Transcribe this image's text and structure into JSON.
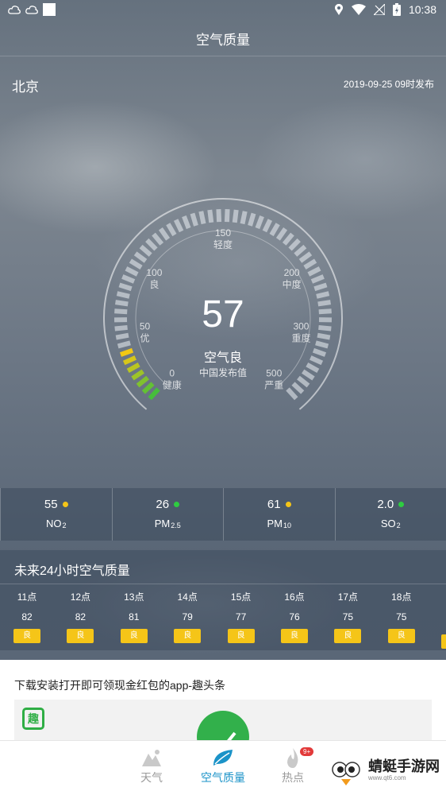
{
  "status_bar": {
    "time": "10:38"
  },
  "header": {
    "title": "空气质量"
  },
  "location": {
    "city": "北京",
    "publish_time": "2019-09-25 09时发布"
  },
  "gauge": {
    "value": "57",
    "level": "空气良",
    "source": "中国发布值",
    "fraction": 0.114,
    "labels": [
      {
        "value": "0",
        "level": "健康"
      },
      {
        "value": "50",
        "level": "优"
      },
      {
        "value": "100",
        "level": "良"
      },
      {
        "value": "150",
        "level": "轻度"
      },
      {
        "value": "200",
        "level": "中度"
      },
      {
        "value": "300",
        "level": "重度"
      },
      {
        "value": "500",
        "level": "严重"
      }
    ]
  },
  "pollutants": [
    {
      "value": "55",
      "name": "NO",
      "sub": "2",
      "status_color": "#f5c518"
    },
    {
      "value": "26",
      "name": "PM",
      "sub": "2.5",
      "status_color": "#2ecc40"
    },
    {
      "value": "61",
      "name": "PM",
      "sub": "10",
      "status_color": "#f5c518"
    },
    {
      "value": "2.0",
      "name": "SO",
      "sub": "2",
      "status_color": "#2ecc40"
    }
  ],
  "forecast": {
    "title": "未来24小时空气质量",
    "hours": [
      {
        "time": "11点",
        "value": "82",
        "level": "良"
      },
      {
        "time": "12点",
        "value": "82",
        "level": "良"
      },
      {
        "time": "13点",
        "value": "81",
        "level": "良"
      },
      {
        "time": "14点",
        "value": "79",
        "level": "良"
      },
      {
        "time": "15点",
        "value": "77",
        "level": "良"
      },
      {
        "time": "16点",
        "value": "76",
        "level": "良"
      },
      {
        "time": "17点",
        "value": "75",
        "level": "良"
      },
      {
        "time": "18点",
        "value": "75",
        "level": "良"
      }
    ],
    "level_color": "#f5c518"
  },
  "ad": {
    "text": "下载安装打开即可领现金红包的app-趣头条",
    "logo_char": "趣"
  },
  "tabs": [
    {
      "label": "天气",
      "icon": "mountain-icon"
    },
    {
      "label": "空气质量",
      "icon": "leaf-icon",
      "active": true
    },
    {
      "label": "热点",
      "icon": "flame-icon",
      "badge": "9+"
    }
  ],
  "watermark": {
    "name": "蜻蜓手游网",
    "url": "www.qt6.com"
  }
}
